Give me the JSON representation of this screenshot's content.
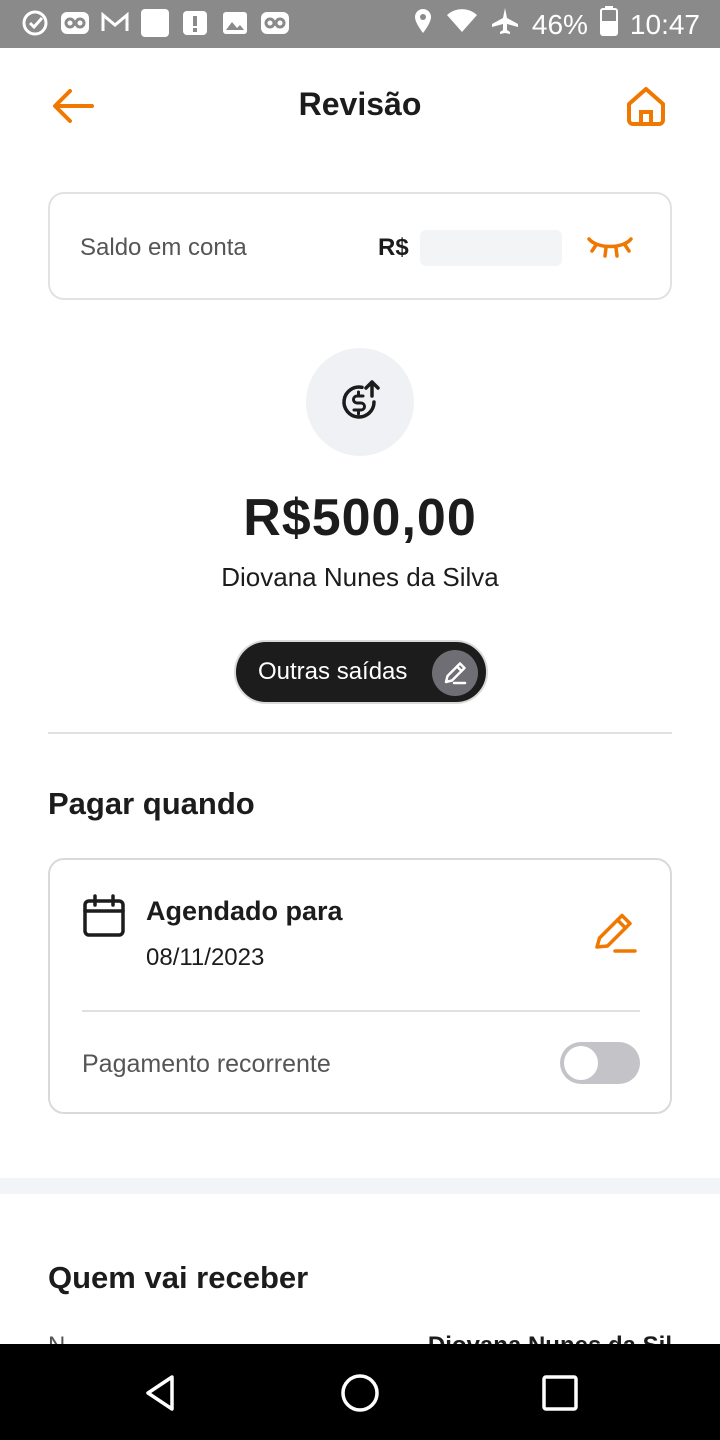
{
  "status_bar": {
    "battery": "46%",
    "time": "10:47",
    "icons": [
      "check-circle-icon",
      "infinity-icon",
      "gmail-icon",
      "square-icon",
      "alert-icon",
      "image-icon",
      "infinity-icon",
      "location-icon",
      "wifi-icon",
      "airplane-icon",
      "battery-icon"
    ]
  },
  "header": {
    "title": "Revisão",
    "back_icon": "arrow-left-icon",
    "home_icon": "home-icon"
  },
  "balance": {
    "label": "Saldo em conta",
    "currency": "R$",
    "toggle_icon": "eye-closed-icon"
  },
  "transfer": {
    "icon": "dollar-send-icon",
    "amount": "R$500,00",
    "recipient": "Diovana Nunes da Silva",
    "category_label": "Outras saídas"
  },
  "pay_when": {
    "title": "Pagar quando",
    "scheduled_label": "Agendado para",
    "scheduled_date": "08/11/2023",
    "recurring_label": "Pagamento recorrente",
    "recurring_enabled": false
  },
  "receiver": {
    "title": "Quem vai receber",
    "row_label_partial": "N",
    "row_value_partial": "Diovana Nunes da Sil"
  },
  "colors": {
    "accent": "#F07800",
    "dark": "#1C1C1C"
  }
}
